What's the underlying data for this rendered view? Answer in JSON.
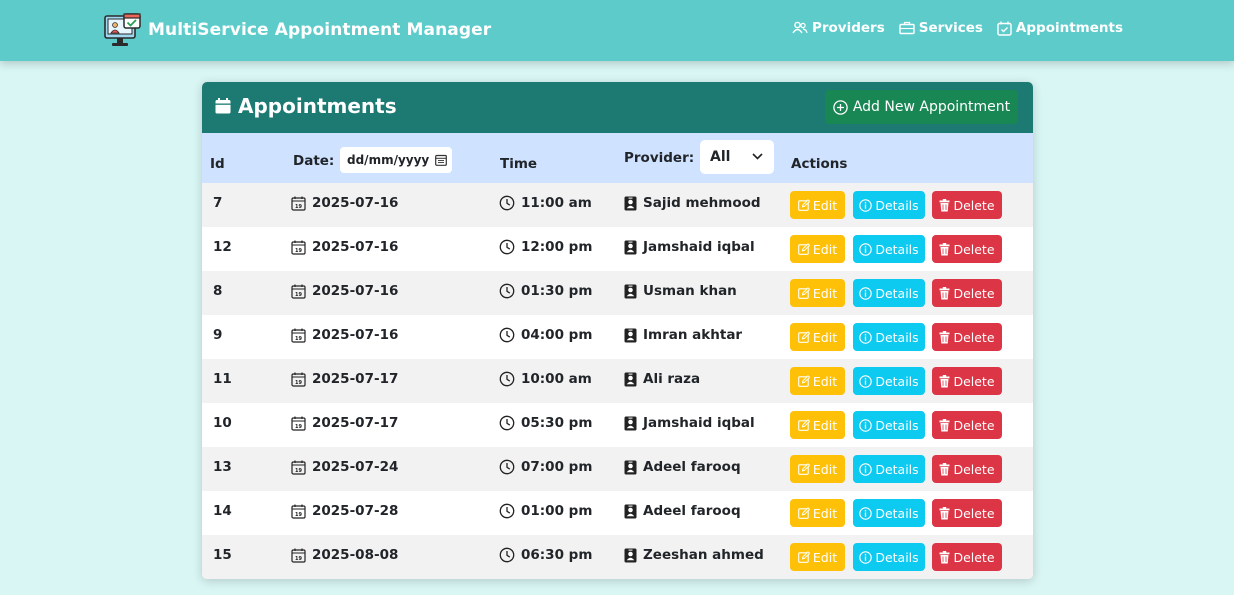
{
  "navbar": {
    "brand": "MultiService Appointment Manager",
    "links": [
      {
        "label": "Providers",
        "icon": "people-icon"
      },
      {
        "label": "Services",
        "icon": "services-icon"
      },
      {
        "label": "Appointments",
        "icon": "calendar-check-icon"
      }
    ]
  },
  "card": {
    "title": "Appointments",
    "add_button": "Add New Appointment"
  },
  "table": {
    "headers": {
      "id": "Id",
      "date": "Date:",
      "time": "Time",
      "provider": "Provider:",
      "actions": "Actions"
    },
    "date_filter_placeholder": "dd/mm/yyyy",
    "provider_filter_value": "All",
    "actions": {
      "edit": "Edit",
      "details": "Details",
      "delete": "Delete"
    },
    "rows": [
      {
        "id": "7",
        "date": "2025-07-16",
        "time": "11:00 am",
        "provider": "Sajid mehmood"
      },
      {
        "id": "12",
        "date": "2025-07-16",
        "time": "12:00 pm",
        "provider": "Jamshaid iqbal"
      },
      {
        "id": "8",
        "date": "2025-07-16",
        "time": "01:30 pm",
        "provider": "Usman khan"
      },
      {
        "id": "9",
        "date": "2025-07-16",
        "time": "04:00 pm",
        "provider": "Imran akhtar"
      },
      {
        "id": "11",
        "date": "2025-07-17",
        "time": "10:00 am",
        "provider": "Ali raza"
      },
      {
        "id": "10",
        "date": "2025-07-17",
        "time": "05:30 pm",
        "provider": "Jamshaid iqbal"
      },
      {
        "id": "13",
        "date": "2025-07-24",
        "time": "07:00 pm",
        "provider": "Adeel farooq"
      },
      {
        "id": "14",
        "date": "2025-07-28",
        "time": "01:00 pm",
        "provider": "Adeel farooq"
      },
      {
        "id": "15",
        "date": "2025-08-08",
        "time": "06:30 pm",
        "provider": "Zeeshan ahmed"
      }
    ]
  },
  "colors": {
    "navbar": "#5ecbcb",
    "page_background": "#d9f6f4",
    "card_header": "#1c7a73",
    "add_button": "#198754",
    "table_header": "#cfe2ff",
    "edit": "#ffc107",
    "details": "#0dcaf0",
    "delete": "#dc3545"
  }
}
